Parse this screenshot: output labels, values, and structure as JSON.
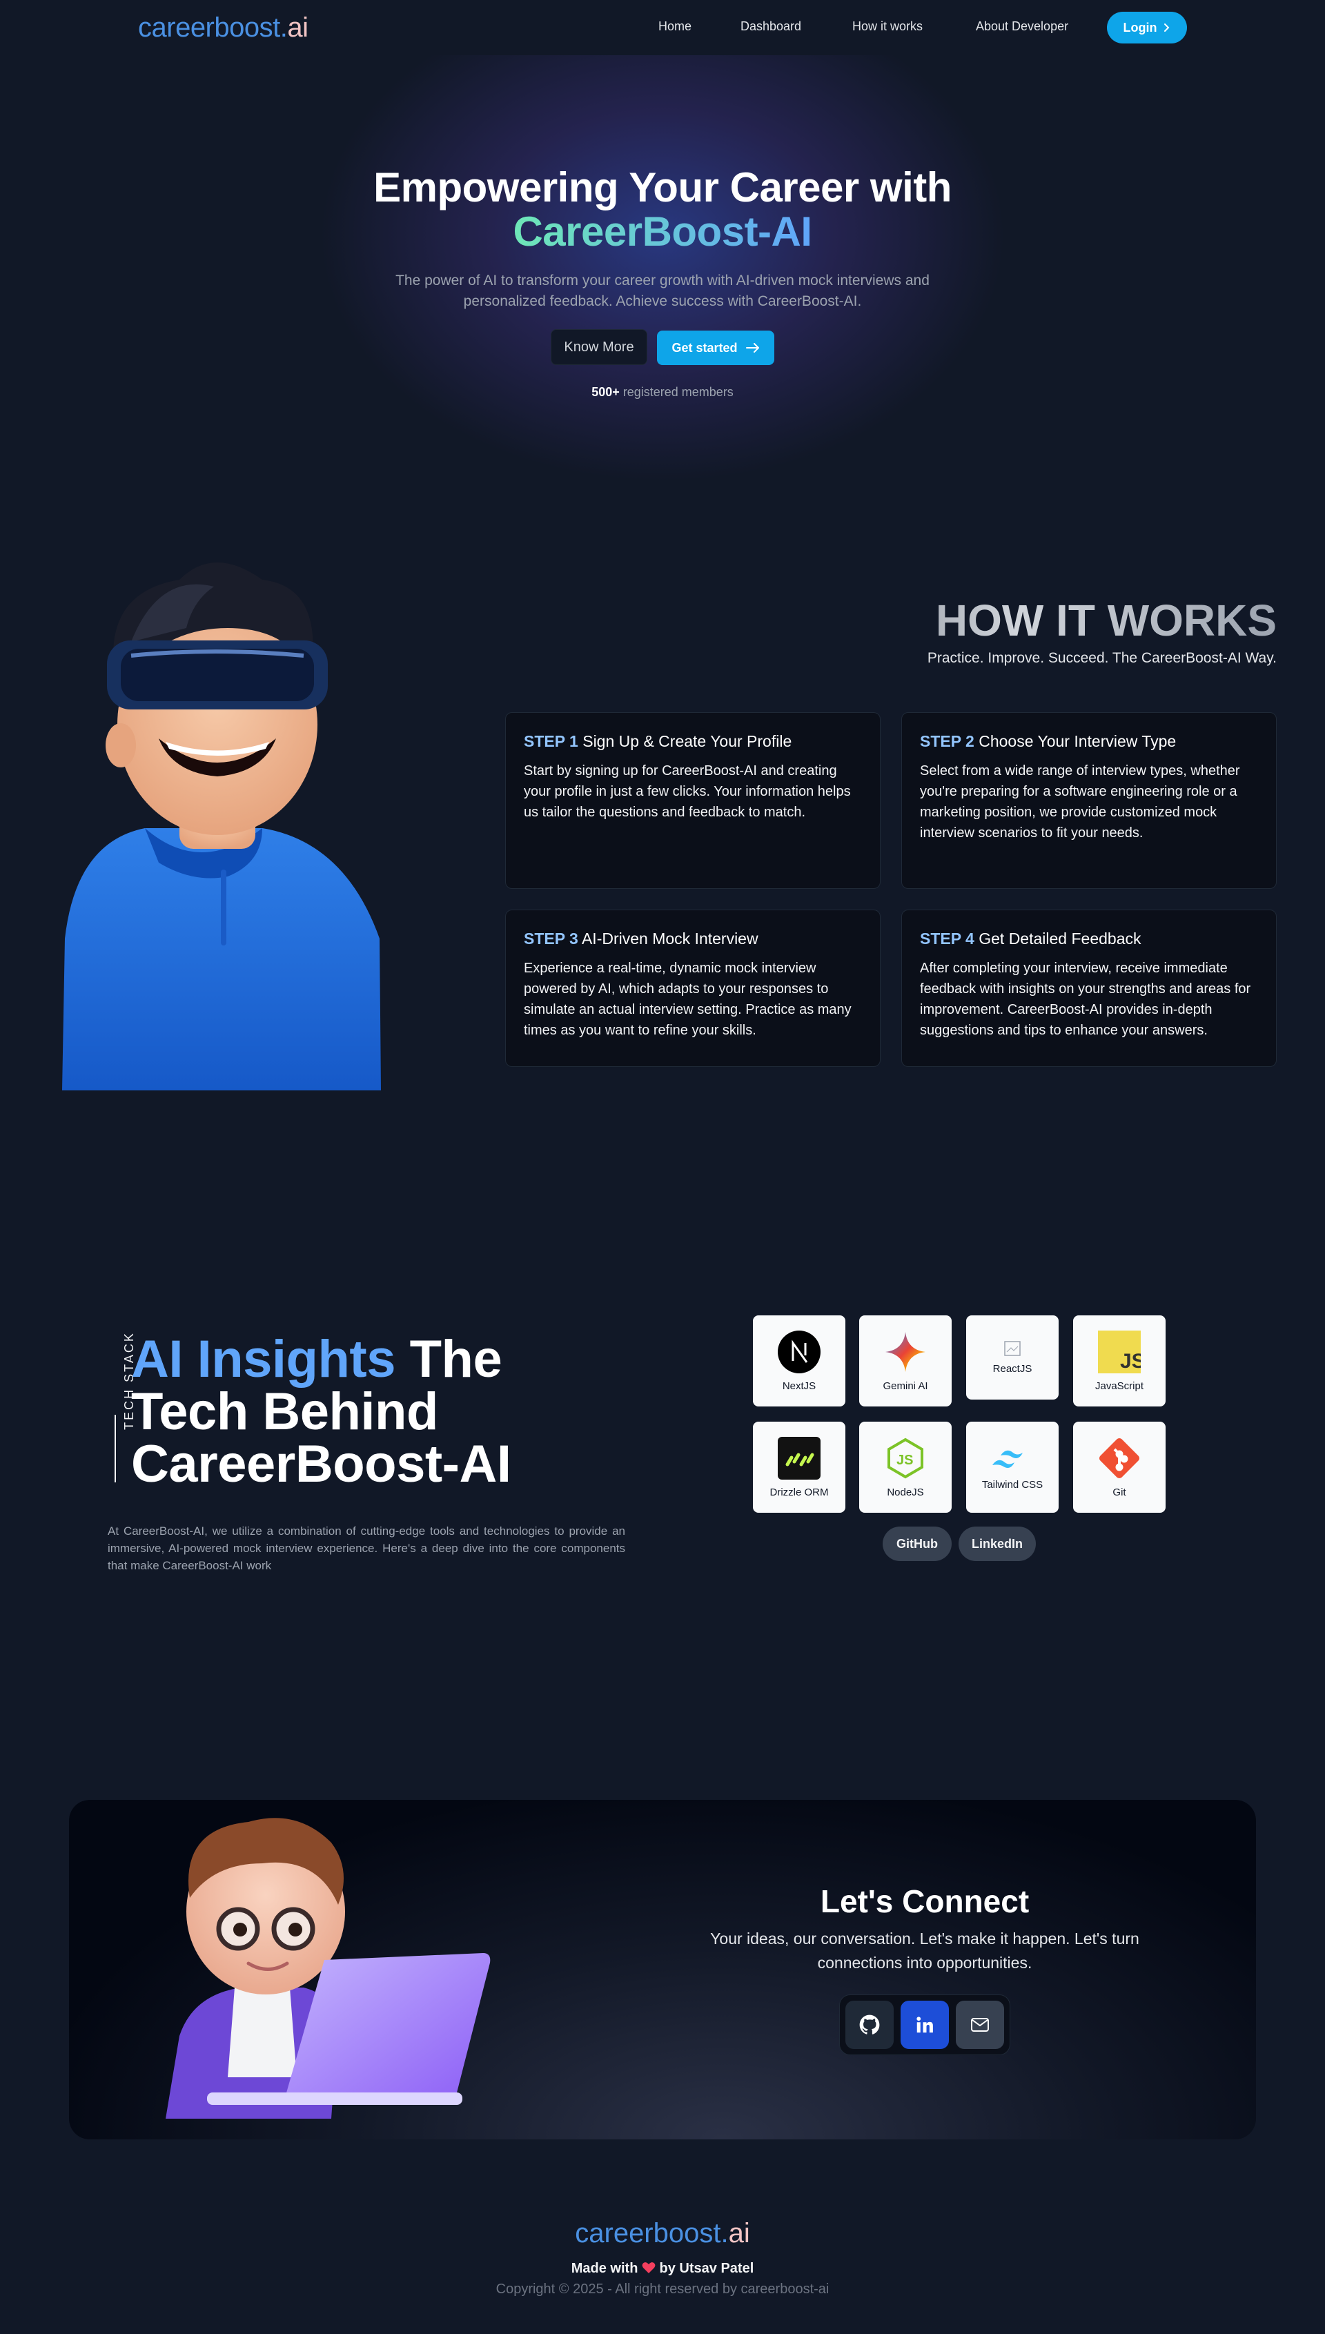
{
  "nav": {
    "brand_main": "careerboost.",
    "brand_ai": "ai",
    "links": [
      "Home",
      "Dashboard",
      "How it works",
      "About Developer"
    ],
    "login": "Login"
  },
  "hero": {
    "title_line1": "Empowering Your Career with",
    "title_line2": "CareerBoost-AI",
    "subtitle": "The power of AI to transform your career growth with AI-driven mock interviews and personalized feedback. Achieve success with CareerBoost-AI.",
    "know_more": "Know More",
    "get_started": "Get started",
    "members_count": "500+",
    "members_label": "registered members"
  },
  "how": {
    "title": "HOW IT WORKS",
    "subtitle": "Practice. Improve. Succeed. The CareerBoost-AI Way.",
    "steps": [
      {
        "num": "STEP 1",
        "title": "Sign Up & Create Your Profile",
        "body": "Start by signing up for CareerBoost-AI and creating your profile in just a few clicks. Your information helps us tailor the questions and feedback to match."
      },
      {
        "num": "STEP 2",
        "title": "Choose Your Interview Type",
        "body": "Select from a wide range of interview types, whether you're preparing for a software engineering role or a marketing position, we provide customized mock interview scenarios to fit your needs."
      },
      {
        "num": "STEP 3",
        "title": "AI-Driven Mock Interview",
        "body": "Experience a real-time, dynamic mock interview powered by AI, which adapts to your responses to simulate an actual interview setting. Practice as many times as you want to refine your skills."
      },
      {
        "num": "STEP 4",
        "title": "Get Detailed Feedback",
        "body": "After completing your interview, receive immediate feedback with insights on your strengths and areas for improvement. CareerBoost-AI provides in-depth suggestions and tips to enhance your answers."
      }
    ]
  },
  "tech": {
    "label": "TECH STACK",
    "title_blue": "AI Insights",
    "title_rest1": "The",
    "title_rest2": "Tech Behind",
    "title_rest3": "CareerBoost-AI",
    "description": "At CareerBoost-AI, we utilize a combination of cutting-edge tools and technologies to provide an immersive, AI-powered mock interview experience. Here's a deep dive into the core components that make CareerBoost-AI work",
    "items": [
      "NextJS",
      "Gemini AI",
      "ReactJS",
      "JavaScript",
      "Drizzle ORM",
      "NodeJS",
      "Tailwind CSS",
      "Git"
    ],
    "links": [
      "GitHub",
      "LinkedIn"
    ]
  },
  "connect": {
    "title": "Let's Connect",
    "subtitle": "Your ideas, our conversation. Let's make it happen. Let's turn connections into opportunities.",
    "icons": [
      "github-icon",
      "linkedin-icon",
      "mail-icon"
    ]
  },
  "footer": {
    "brand_main": "careerboost.",
    "brand_ai": "ai",
    "made_prefix": "Made with",
    "made_suffix": "by Utsav Patel",
    "copyright": "Copyright © 2025 - All right reserved by careerboost-ai"
  },
  "colors": {
    "background": "#111827",
    "accent": "#0ea5e9",
    "brand_blue": "#4a90e2",
    "brand_pink": "#f2c4c4",
    "step_blue": "#93c5fd"
  }
}
